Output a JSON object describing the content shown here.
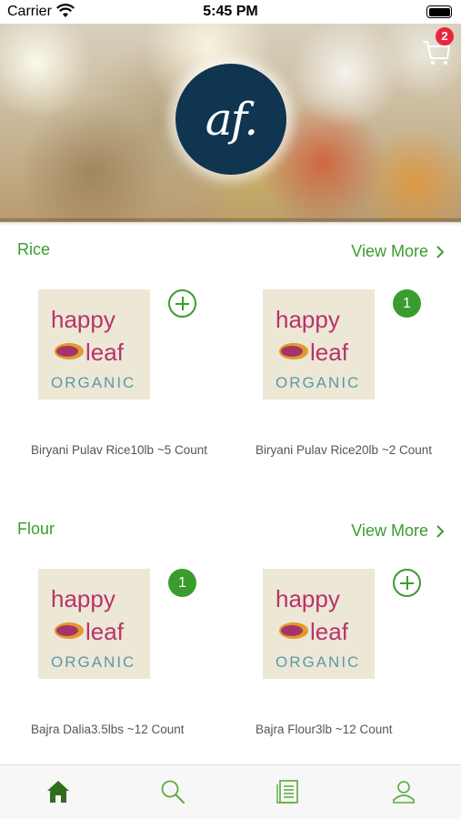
{
  "status_bar": {
    "carrier": "Carrier",
    "time": "5:45 PM"
  },
  "header": {
    "logo_text": "af.",
    "cart_count": "2"
  },
  "colors": {
    "accent": "#3a9c2e",
    "badge": "#e8263f",
    "logo_bg": "#0f3550"
  },
  "sections": [
    {
      "title": "Rice",
      "view_more": "View More",
      "products": [
        {
          "name": "Biryani Pulav Rice10lb ~5 Count",
          "brand_line1": "happy",
          "brand_line2": "leaf",
          "brand_line3": "ORGANIC",
          "qty": ""
        },
        {
          "name": "Biryani Pulav Rice20lb ~2 Count",
          "brand_line1": "happy",
          "brand_line2": "leaf",
          "brand_line3": "ORGANIC",
          "qty": "1"
        }
      ]
    },
    {
      "title": "Flour",
      "view_more": "View More",
      "products": [
        {
          "name": "Bajra Dalia3.5lbs ~12 Count",
          "brand_line1": "happy",
          "brand_line2": "leaf",
          "brand_line3": "ORGANIC",
          "qty": "1"
        },
        {
          "name": "Bajra Flour3lb ~12 Count",
          "brand_line1": "happy",
          "brand_line2": "leaf",
          "brand_line3": "ORGANIC",
          "qty": ""
        }
      ]
    }
  ],
  "tab_bar": {
    "items": [
      "home-icon",
      "search-icon",
      "orders-icon",
      "profile-icon"
    ],
    "active": "home-icon"
  }
}
